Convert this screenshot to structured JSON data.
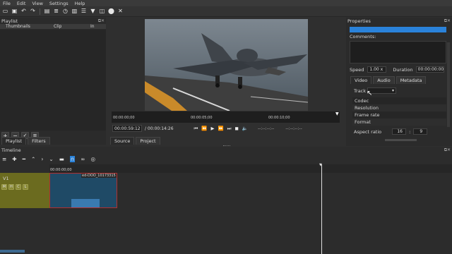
{
  "menu": [
    "File",
    "Edit",
    "View",
    "Settings",
    "Help"
  ],
  "toolbar_icons": [
    "open-icon",
    "save-icon",
    "undo-icon",
    "redo-icon",
    "delete-icon",
    "timeline-icon",
    "clock-icon",
    "bars-icon",
    "filter-icon",
    "funnel-icon",
    "export-icon",
    "close-icon",
    "fullscreen-icon"
  ],
  "playlist": {
    "title": "Playlist",
    "columns": [
      "Thumbnails",
      "Clip",
      "In"
    ],
    "tab_playlist": "Playlist",
    "tab_filters": "Filters"
  },
  "player": {
    "ruler": [
      "00:00:00;00",
      "00:00:05;00",
      "00:00:10;00"
    ],
    "current_time": "00:00:59:12",
    "total_time": "/ 00:00:14:26",
    "in_point": "--:--:--:--",
    "out_point": "--:--:--:--",
    "tab_source": "Source",
    "tab_project": "Project"
  },
  "properties": {
    "title": "Properties",
    "comments_label": "Comments:",
    "speed_label": "Speed",
    "speed_value": "1.00 x",
    "duration_label": "Duration",
    "duration_value": "00:00:00:00",
    "tabs": [
      "Video",
      "Audio",
      "Metadata"
    ],
    "track_label": "Track",
    "rows": [
      "Codec",
      "Resolution",
      "Frame rate",
      "Format"
    ],
    "aspect_label": "Aspect ratio",
    "aspect_num": "16",
    "aspect_sep": ":",
    "aspect_den": "9"
  },
  "timeline": {
    "title": "Timeline",
    "ruler_time": "00:00:00;00",
    "track_name": "V1",
    "track_buttons": [
      "M",
      "H",
      "C",
      "L"
    ],
    "clip_label": "ed-DOO_10173315"
  },
  "colors": {
    "accent": "#2a82da",
    "track_head": "#6b6b1f",
    "clip": "#1f4a66",
    "clip_border": "#b03030"
  }
}
